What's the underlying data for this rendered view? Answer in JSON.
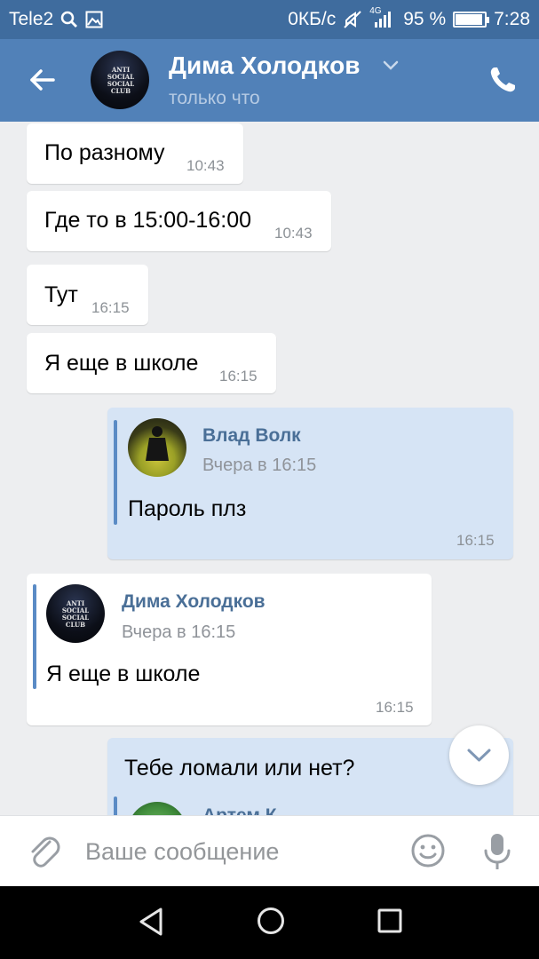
{
  "status_bar": {
    "carrier": "Tele2",
    "speed": "0КБ/с",
    "network": "4G",
    "battery_percent": "95 %",
    "battery_level": 0.95,
    "time": "7:28"
  },
  "header": {
    "contact_name": "Дима Холодков",
    "contact_status": "только что",
    "avatar_text": "ANTI SOCIAL SOCIAL CLUB"
  },
  "messages": [
    {
      "direction": "incoming",
      "text": "По разному",
      "time": "10:43"
    },
    {
      "direction": "incoming",
      "text": "Где то в 15:00-16:00",
      "time": "10:43"
    },
    {
      "direction": "incoming",
      "text": "Тут",
      "time": "16:15"
    },
    {
      "direction": "incoming",
      "text": "Я еще в школе",
      "time": "16:15"
    },
    {
      "direction": "outgoing",
      "forwarded": {
        "author": "Влад Волк",
        "date": "Вчера в 16:15",
        "text": "Пароль плз"
      },
      "time": "16:15"
    },
    {
      "direction": "incoming",
      "forwarded": {
        "author": "Дима Холодков",
        "date": "Вчера в 16:15",
        "text": "Я еще в школе"
      },
      "time": "16:15"
    },
    {
      "direction": "outgoing",
      "text": "Тебе ломали или нет?",
      "forwarded_partial": {
        "author": "Артем К..."
      }
    }
  ],
  "composer": {
    "placeholder": "Ваше сообщение"
  },
  "icons": {
    "back": "arrow-left-icon",
    "call": "phone-icon",
    "attach": "paperclip-icon",
    "emoji": "smile-icon",
    "voice": "microphone-icon",
    "scroll": "chevron-down-icon"
  },
  "colors": {
    "header": "#5181b8",
    "status_bar": "#3f6c9e",
    "chat_bg": "#edeef0",
    "outgoing_bubble": "#d6e4f5",
    "link_name": "#4a6f97"
  }
}
